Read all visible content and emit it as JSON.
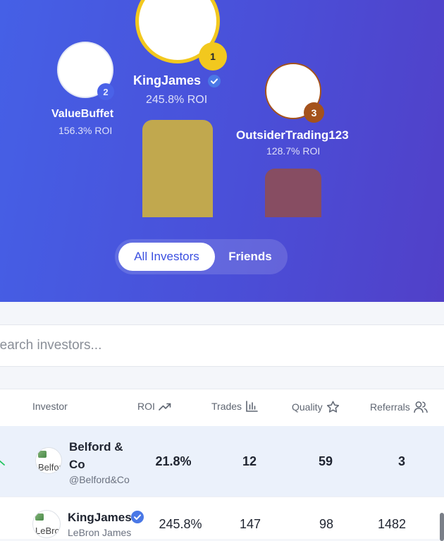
{
  "podium": {
    "first": {
      "rank": "1",
      "name": "KingJames",
      "roi": "245.8% ROI"
    },
    "second": {
      "rank": "2",
      "name": "ValueBuffet",
      "roi": "156.3% ROI"
    },
    "third": {
      "rank": "3",
      "name": "OutsiderTrading123",
      "roi": "128.7% ROI"
    }
  },
  "filter_tabs": [
    "All Investors",
    "Friends"
  ],
  "search": {
    "placeholder": "Search investors..."
  },
  "table": {
    "headers": {
      "investor": "Investor",
      "roi": "ROI",
      "trades": "Trades",
      "quality": "Quality",
      "referrals": "Referrals"
    },
    "rows": [
      {
        "name": "Belford & Co",
        "handle": "@Belford&Co",
        "avatar_alt": "Belford",
        "roi": "21.8%",
        "trades": "12",
        "quality": "59",
        "referrals": "3"
      },
      {
        "name": "KingJames",
        "handle": "LeBron James",
        "avatar_alt": "LeBron",
        "roi": "245.8%",
        "trades": "147",
        "quality": "98",
        "referrals": "1482"
      }
    ]
  },
  "colors": {
    "gold": "#f2c81e",
    "silver": "#4a62e8",
    "bronze": "#a4521c",
    "gold_bar": "#c1a84e",
    "bronze_bar": "#874d62",
    "verified": "#4a78e6"
  }
}
